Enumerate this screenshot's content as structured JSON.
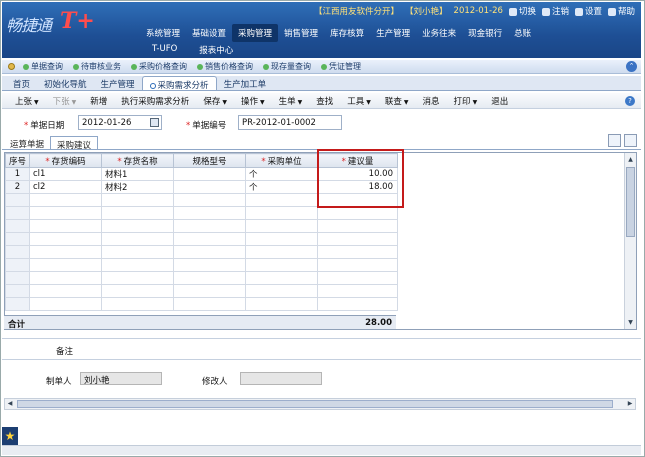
{
  "header": {
    "brand": "畅捷通",
    "tplus": "T+",
    "company": "【江西用友软件分开】",
    "user": "【刘小艳】",
    "date": "2012-01-26",
    "switch": "切换",
    "logout": "注销",
    "settings": "设置",
    "help": "帮助"
  },
  "main_menu": [
    "系统管理",
    "基础设置",
    "采购管理",
    "销售管理",
    "库存核算",
    "生产管理",
    "业务往来",
    "现金银行",
    "总账"
  ],
  "sub_menu": [
    "T-UFO",
    "报表中心"
  ],
  "shortcuts": [
    "单据查询",
    "待审核业务",
    "采购价格查询",
    "销售价格查询",
    "现存量查询",
    "凭证管理"
  ],
  "tabs": [
    "首页",
    "初始化导航",
    "生产管理",
    "采购需求分析",
    "生产加工单"
  ],
  "toolbar": {
    "items": [
      "上张",
      "下张",
      "新增",
      "执行采购需求分析",
      "保存",
      "操作",
      "生单",
      "查找",
      "工具",
      "联查",
      "消息",
      "打印",
      "退出"
    ]
  },
  "form": {
    "date_label": "单据日期",
    "date_value": "2012-01-26",
    "code_label": "单据编号",
    "code_value": "PR-2012-01-0002"
  },
  "subtabs": [
    "运算单据",
    "采购建议"
  ],
  "grid": {
    "headers": [
      "序号",
      "存货编码",
      "存货名称",
      "规格型号",
      "采购单位",
      "建议量"
    ],
    "rows": [
      {
        "no": "1",
        "code": "cl1",
        "name": "材料1",
        "spec": "",
        "unit": "个",
        "qty": "10.00"
      },
      {
        "no": "2",
        "code": "cl2",
        "name": "材料2",
        "spec": "",
        "unit": "个",
        "qty": "18.00"
      }
    ],
    "total_label": "合计",
    "total_value": "28.00"
  },
  "footer": {
    "remark_label": "备注",
    "maker_label": "制单人",
    "maker_value": "刘小艳",
    "modifier_label": "修改人",
    "modifier_value": ""
  }
}
